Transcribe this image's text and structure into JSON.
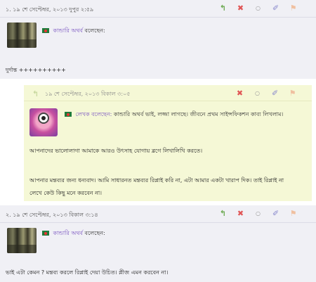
{
  "comments": [
    {
      "number": "১. ১৯ শে সেপ্টেম্বর, ২০১৩ দুপুর ২:৫৯",
      "author": "কান্ডারি অথর্ব",
      "said": "বলেছেন:",
      "text": "দুর্দান্ত ++++++++++"
    },
    {
      "date": "১৯ শে সেপ্টেম্বর, ২০১৩ বিকাল ৩:০৫",
      "author_label": "লেখক বলেছেন:",
      "first_line": "কান্ডারি অথর্ব ভাই, লজ্জা লাগছে। জীবনে প্রথম সাইন্সফিকশন কাব্য লিখলাম।",
      "paragraph2": "আপনাদের ভালোলাগা আমাকে আরও উৎসাহ যোগায় ব্লগে লিখালিখি করতে।",
      "paragraph3_line1": "আপনার মন্তব্যর জন্য ধন্যবাদ। আমি সাধারনত মন্তব্যর রিপ্লাই করি না, এটা আমার একটা খারাপ দিক। তাই রিপ্লাই না",
      "paragraph3_line2": "লেখে কেউ কিছু মনে করবেন না।"
    },
    {
      "number": "২. ১৯ শে সেপ্টেম্বর, ২০১৩ বিকাল ৩:১৪",
      "author": "কান্ডারি অথর্ব",
      "said": "বলেছেন:",
      "text": "ভাই এটা কেমন ? মন্তব্য করলে রিপ্লাই দেয়া উচিত। প্লীজ এমন করবেন না।"
    }
  ],
  "icons": {
    "reply": "↰",
    "delete": "✖",
    "rate": "○",
    "edit": "✐",
    "flag": "⚑"
  }
}
